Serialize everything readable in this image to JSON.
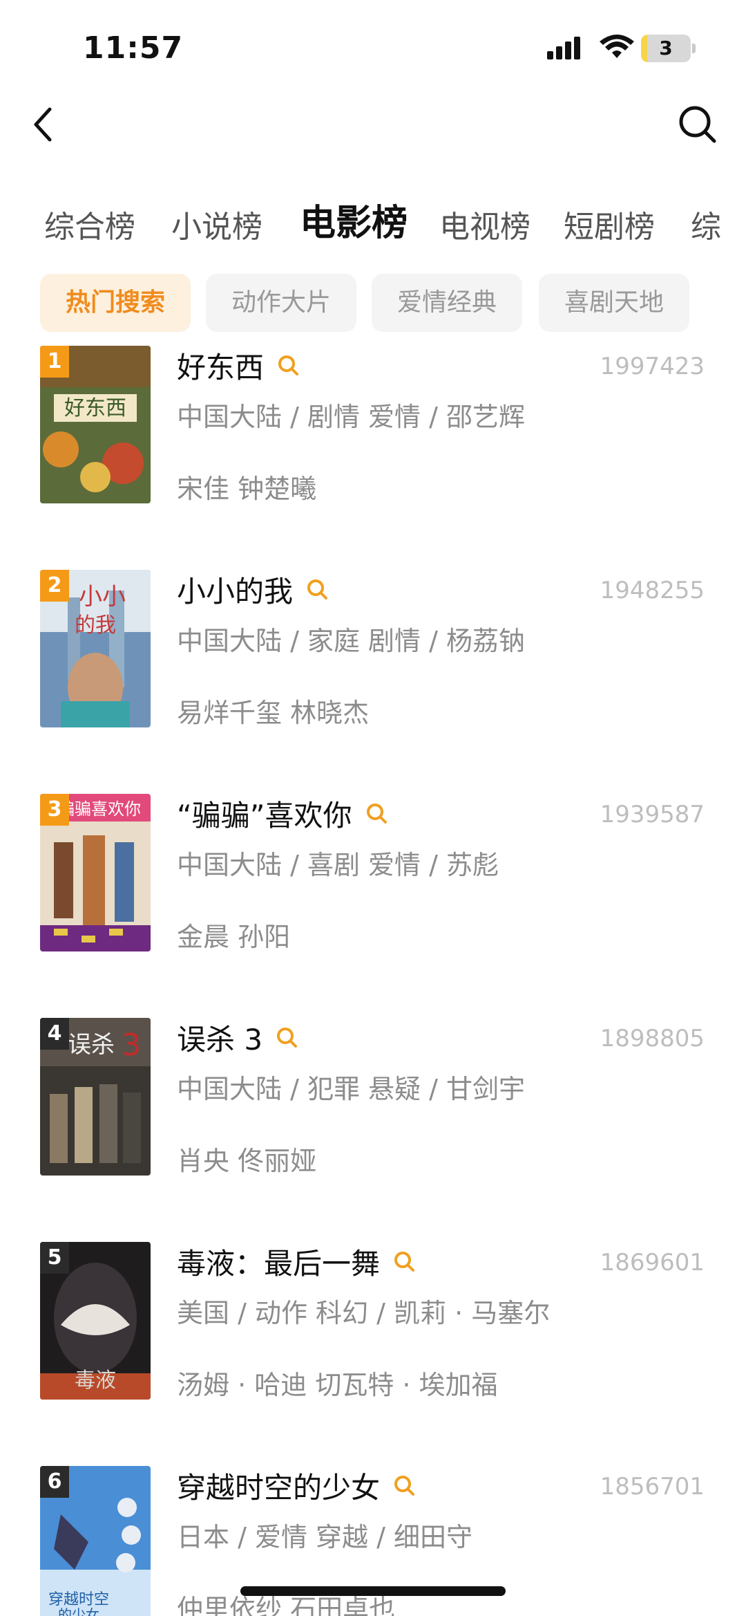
{
  "status_bar": {
    "time": "11:57",
    "battery_level": "3",
    "battery_fraction": 0.03
  },
  "nav": {
    "back_icon": "chevron-left-icon",
    "search_icon": "search-icon"
  },
  "category_tabs": [
    "综合榜",
    "小说榜",
    "电影榜",
    "电视榜",
    "短剧榜",
    "综"
  ],
  "active_category_index": 2,
  "genre_chips": [
    "热门搜索",
    "动作大片",
    "爱情经典",
    "喜剧天地"
  ],
  "active_chip_index": 0,
  "colors": {
    "accent": "#f08c1e",
    "rank_top": "#f59a16",
    "rank_other": "#2b2b2b"
  },
  "movies": [
    {
      "rank": "1",
      "title": "好东西",
      "score": "1997423",
      "meta": "中国大陆 / 剧情 爱情 / 邵艺辉",
      "cast": "宋佳 钟楚曦"
    },
    {
      "rank": "2",
      "title": "小小的我",
      "score": "1948255",
      "meta": "中国大陆 / 家庭 剧情 / 杨荔钠",
      "cast": "易烊千玺 林晓杰"
    },
    {
      "rank": "3",
      "title": "“骗骗”喜欢你",
      "score": "1939587",
      "meta": "中国大陆 / 喜剧 爱情 / 苏彪",
      "cast": "金晨 孙阳"
    },
    {
      "rank": "4",
      "title": "误杀 3",
      "score": "1898805",
      "meta": "中国大陆 / 犯罪 悬疑 / 甘剑宇",
      "cast": "肖央 佟丽娅"
    },
    {
      "rank": "5",
      "title": "毒液：最后一舞",
      "score": "1869601",
      "meta": "美国 / 动作 科幻 / 凯莉 · 马塞尔",
      "cast": "汤姆 · 哈迪   切瓦特 · 埃加福"
    },
    {
      "rank": "6",
      "title": "穿越时空的少女",
      "score": "1856701",
      "meta": "日本 / 爱情 穿越 / 细田守",
      "cast": "仲里依纱 石田卓也"
    }
  ]
}
